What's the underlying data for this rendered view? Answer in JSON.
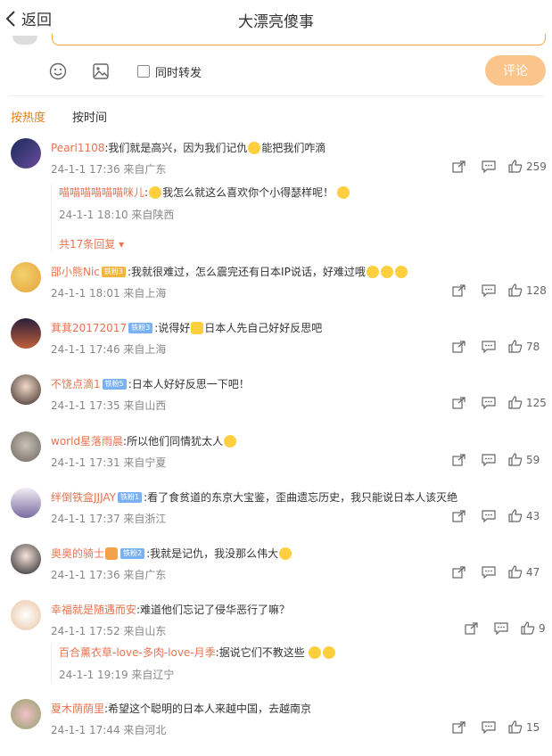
{
  "header": {
    "back_label": "返回",
    "title": "大漂亮傻事"
  },
  "toolbar": {
    "repost_label": "同时转发",
    "submit_label": "评论"
  },
  "tabs": [
    {
      "label": "按热度"
    },
    {
      "label": "按时间"
    }
  ],
  "comments": [
    {
      "user": "Pearl1108",
      "text_a": ":我们就是高兴，因为我们记仇",
      "text_b": "能把我们咋滴",
      "time": "24-1-1 17:36 来自广东",
      "likes": "259",
      "reply": {
        "user": "喵喵喵喵喵喵咪儿",
        "text": "我怎么就这么喜欢你个小得瑟样呢！",
        "time": "24-1-1 18:10 来自陕西",
        "more": "共17条回复"
      }
    },
    {
      "user": "邵小熊Nic",
      "badge": "铁粉3",
      "text": ":我就很难过，怎么震完还有日本IP说话，好难过哦",
      "time": "24-1-1 18:01 来自上海",
      "likes": "128"
    },
    {
      "user": "萁萁20172017",
      "badge": "铁粉3",
      "text_a": ":说得好",
      "text_b": "日本人先自己好好反思吧",
      "time": "24-1-1 17:46 来自上海",
      "likes": "78"
    },
    {
      "user": "不饶点滴1",
      "badge": "铁粉5",
      "text": ":日本人好好反思一下吧！",
      "time": "24-1-1 17:35 来自山西",
      "likes": "125"
    },
    {
      "user": "world星落雨晨",
      "text": ":所以他们同情犹太人",
      "time": "24-1-1 17:31 来自宁夏",
      "likes": "59"
    },
    {
      "user": "绊倒铁盒JJJAY",
      "badge": "铁粉1",
      "text": ":看了食贫道的东京大宝鉴，歪曲遗忘历史，我只能说日本人该灭绝",
      "time": "24-1-1 17:37 来自浙江",
      "likes": "43"
    },
    {
      "user": "奥奥的骑士",
      "badge": "铁粉2",
      "text": ":我就是记仇，我没那么伟大",
      "time": "24-1-1 17:36 来自广东",
      "likes": "47"
    },
    {
      "user": "幸福就是随遇而安",
      "text": ":难道他们忘记了侵华恶行了嘛？",
      "time": "24-1-1 17:52 来自山东",
      "likes": "9",
      "reply": {
        "user": "百合薰衣草-love-多肉-love-月季",
        "text": ":据说它们不教这些",
        "time": "24-1-1 19:19 来自辽宁"
      }
    },
    {
      "user": "夏木荫荫里",
      "text": ":希望这个聪明的日本人来越中国，去越南京",
      "time": "24-1-1 17:44 来自河北",
      "likes": "15"
    }
  ]
}
